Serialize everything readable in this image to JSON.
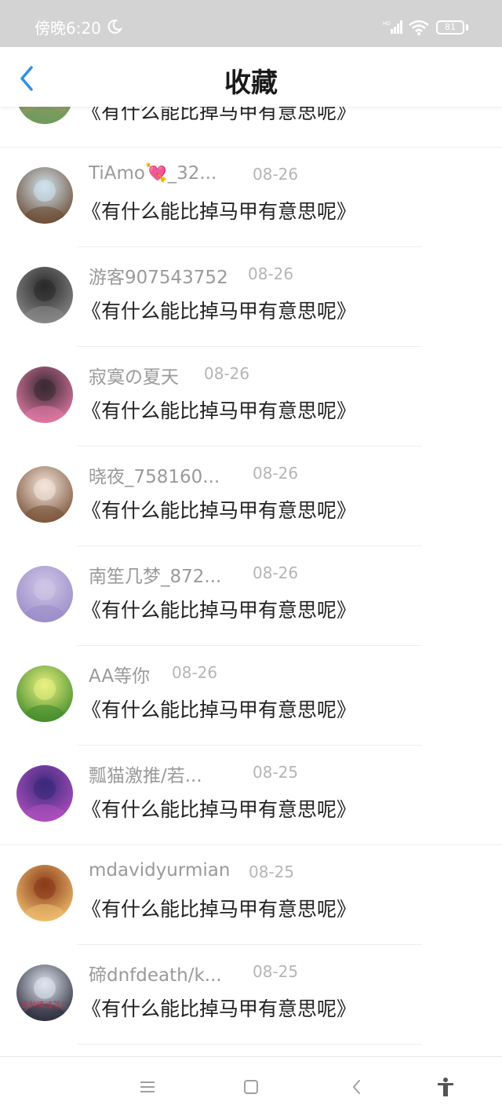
{
  "status_bar": {
    "time": "傍晚6:20",
    "battery": "81",
    "icons": [
      "moon-icon",
      "hd-signal-icon",
      "wifi-icon",
      "battery-icon"
    ]
  },
  "header": {
    "title": "收藏",
    "back_icon": "chevron-left-icon"
  },
  "items": [
    {
      "username": "",
      "date": "",
      "content": "《有什么能比掉马甲有意思呢》",
      "avatar_colors": [
        "#d89a7a",
        "#6a9a5a"
      ]
    },
    {
      "username": "TiAmo💘_32...",
      "date": "08-26",
      "content": "《有什么能比掉马甲有意思呢》",
      "avatar_colors": [
        "#cfe3ef",
        "#6b4a32"
      ]
    },
    {
      "username": "游客907543752",
      "date": "08-26",
      "content": "《有什么能比掉马甲有意思呢》",
      "avatar_colors": [
        "#2a2a2a",
        "#8a8a8a"
      ]
    },
    {
      "username": "寂寞の夏天",
      "date": "08-26",
      "content": "《有什么能比掉马甲有意思呢》",
      "avatar_colors": [
        "#3a2a32",
        "#e27aa6"
      ]
    },
    {
      "username": "晓夜_758160...",
      "date": "08-26",
      "content": "《有什么能比掉马甲有意思呢》",
      "avatar_colors": [
        "#f4e6dc",
        "#7a5238"
      ]
    },
    {
      "username": "南笙几梦_872...",
      "date": "08-26",
      "content": "《有什么能比掉马甲有意思呢》",
      "avatar_colors": [
        "#cfc6e6",
        "#9a8cc8"
      ]
    },
    {
      "username": "AA等你",
      "date": "08-26",
      "content": "《有什么能比掉马甲有意思呢》",
      "avatar_colors": [
        "#e8f080",
        "#3f8a2a"
      ]
    },
    {
      "username": "瓢猫激推/若...",
      "date": "08-25",
      "content": "《有什么能比掉马甲有意思呢》",
      "avatar_colors": [
        "#3a2a7a",
        "#b050c0"
      ]
    },
    {
      "username": "mdavidyurmian",
      "date": "08-25",
      "content": "《有什么能比掉马甲有意思呢》",
      "avatar_colors": [
        "#8a3a1a",
        "#f0c070"
      ]
    },
    {
      "username": "碲dnfdeath/k...",
      "date": "08-25",
      "content": "《有什么能比掉马甲有意思呢》",
      "avatar_colors": [
        "#dfe6f0",
        "#2a2a3a"
      ],
      "avatar_text": "这种情绪范儿"
    }
  ],
  "nav_bar": {
    "buttons": [
      "menu-icon",
      "home-icon",
      "back-icon",
      "accessibility-icon"
    ]
  }
}
